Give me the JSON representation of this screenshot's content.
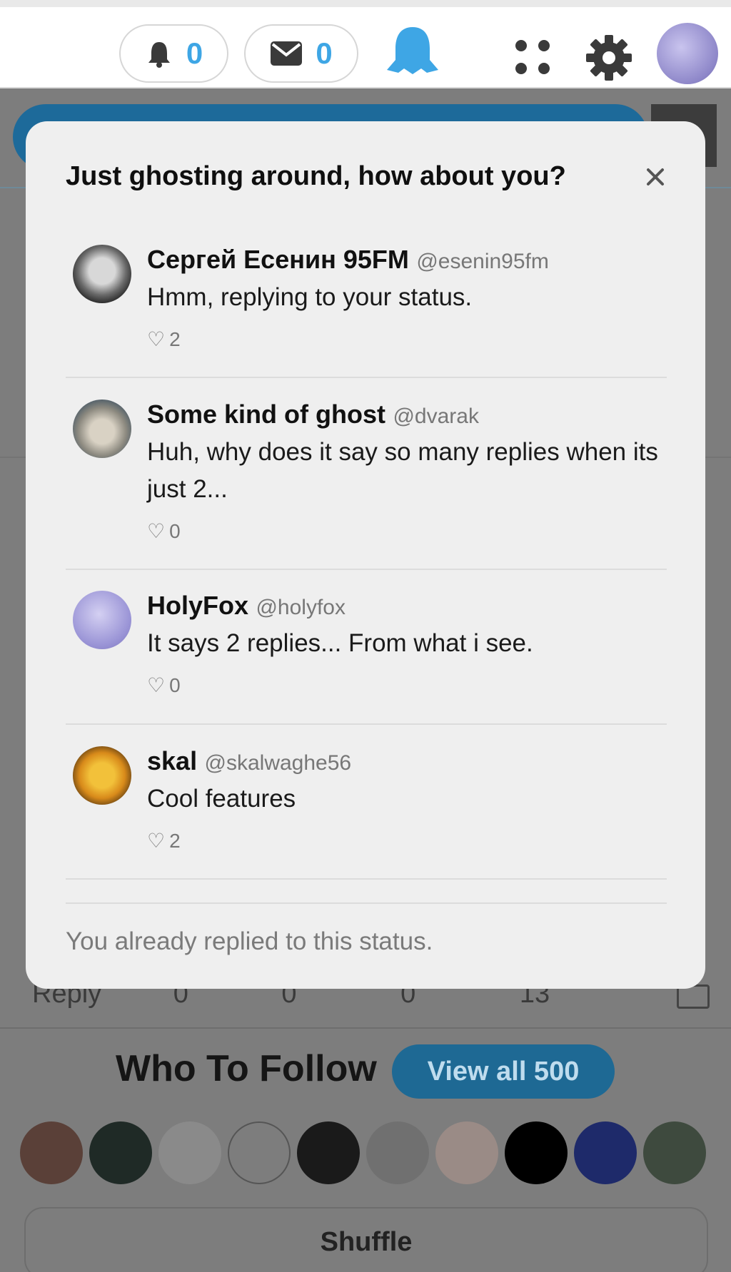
{
  "topbar": {
    "notifications_count": "0",
    "messages_count": "0",
    "icons": [
      "bell-icon",
      "envelope-icon",
      "ghost-icon",
      "apps-grid-icon",
      "gear-icon",
      "user-avatar"
    ],
    "accent": "#3ea6e5"
  },
  "background_page": {
    "reply_label": "Reply",
    "reply_counts": [
      "0",
      "0",
      "0",
      "13"
    ],
    "who_to_follow": "Who To Follow",
    "view_all": "View all 500",
    "shuffle": "Shuffle"
  },
  "modal": {
    "title": "Just ghosting around, how about you?",
    "close_symbol": "×",
    "replies": [
      {
        "name": "Сергей Есенин 95FM",
        "handle": "@esenin95fm",
        "text": "Hmm, replying to your status.",
        "likes": "2"
      },
      {
        "name": "Some kind of ghost",
        "handle": "@dvarak",
        "text": "Huh, why does it say so many replies when its just 2...",
        "likes": "0"
      },
      {
        "name": "HolyFox",
        "handle": "@holyfox",
        "text": "It says 2 replies... From what i see.",
        "likes": "0"
      },
      {
        "name": "skal",
        "handle": "@skalwaghe56",
        "text": "Cool features",
        "likes": "2"
      }
    ],
    "footer": "You already replied to this status."
  }
}
